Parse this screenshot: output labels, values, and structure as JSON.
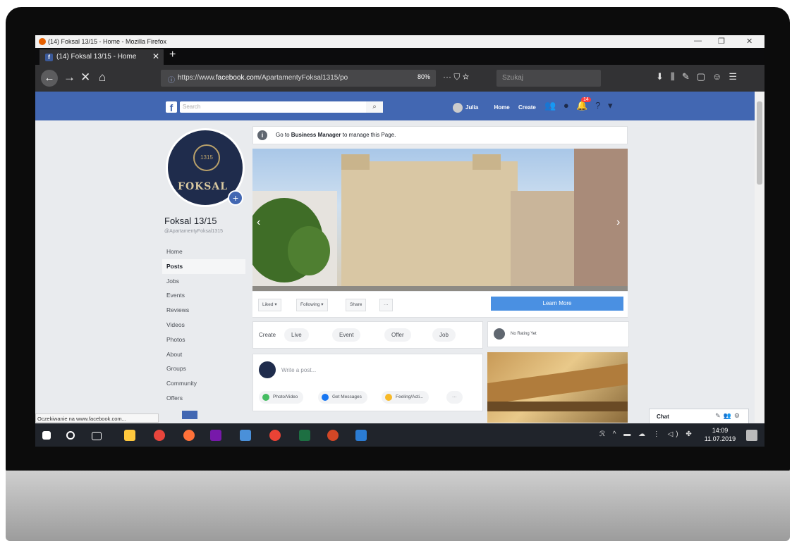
{
  "browser": {
    "window_title": "(14) Foksal 13/15 - Home - Mozilla Firefox",
    "tab_title": "(14) Foksal 13/15 - Home",
    "url_prefix": "https://www.",
    "url_domain": "facebook.com",
    "url_path": "/ApartamentyFoksal1315/po",
    "zoom": "80%",
    "search_placeholder": "Szukaj",
    "status_text": "Oczekiwanie na www.facebook.com..."
  },
  "facebook": {
    "search_placeholder": "Search",
    "nav": {
      "user": "Julia",
      "home": "Home",
      "create": "Create",
      "notification_count": "14"
    },
    "page": {
      "name": "Foksal 13/15",
      "handle": "@ApartamentyFoksal1315",
      "logo_text": "FOKSAL",
      "crest_text": "1315"
    },
    "left_nav": [
      "Home",
      "Posts",
      "Jobs",
      "Events",
      "Reviews",
      "Videos",
      "Photos",
      "About",
      "Groups",
      "Community",
      "Offers"
    ],
    "active_nav": "Posts",
    "business_notice": {
      "pre": "Go to ",
      "link": "Business Manager",
      "post": " to manage this Page."
    },
    "actions": {
      "liked": "Liked ▾",
      "following": "Following ▾",
      "share": "Share",
      "more": "···",
      "learn_more": "Learn More"
    },
    "create": {
      "label": "Create",
      "live": "Live",
      "event": "Event",
      "offer": "Offer",
      "job": "Job"
    },
    "rating": "No Rating Yet",
    "composer": {
      "placeholder": "Write a post...",
      "photo_video": "Photo/Video",
      "get_messages": "Get Messages",
      "feeling": "Feeling/Acti...",
      "more": "···"
    },
    "chat": {
      "label": "Chat"
    }
  },
  "taskbar": {
    "time": "14:09",
    "date": "11.07.2019"
  },
  "colors": {
    "fb_blue": "#4267b2",
    "learn_more": "#4a90e2",
    "notification": "#fa3e3e"
  }
}
